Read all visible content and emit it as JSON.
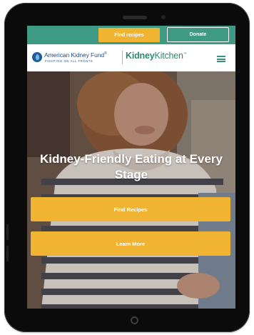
{
  "header": {
    "find_recipes_label": "Find recipes",
    "donate_label": "Donate"
  },
  "nav": {
    "akf_name": "American Kidney Fund",
    "akf_trademark": "®",
    "akf_tagline": "FIGHTING ON ALL FRONTS",
    "kk_part1": "Kidney",
    "kk_part2": "Kitchen",
    "kk_trademark": "™",
    "menu_icon": "hamburger-menu-icon"
  },
  "hero": {
    "title": "Kidney-Friendly Eating at Every Stage",
    "find_recipes_label": "Find Recipes",
    "learn_more_label": "Learn More"
  },
  "colors": {
    "teal": "#3f9a84",
    "gold": "#f1b332",
    "navy": "#1f4f8a",
    "kk_green": "#2c8a73"
  }
}
